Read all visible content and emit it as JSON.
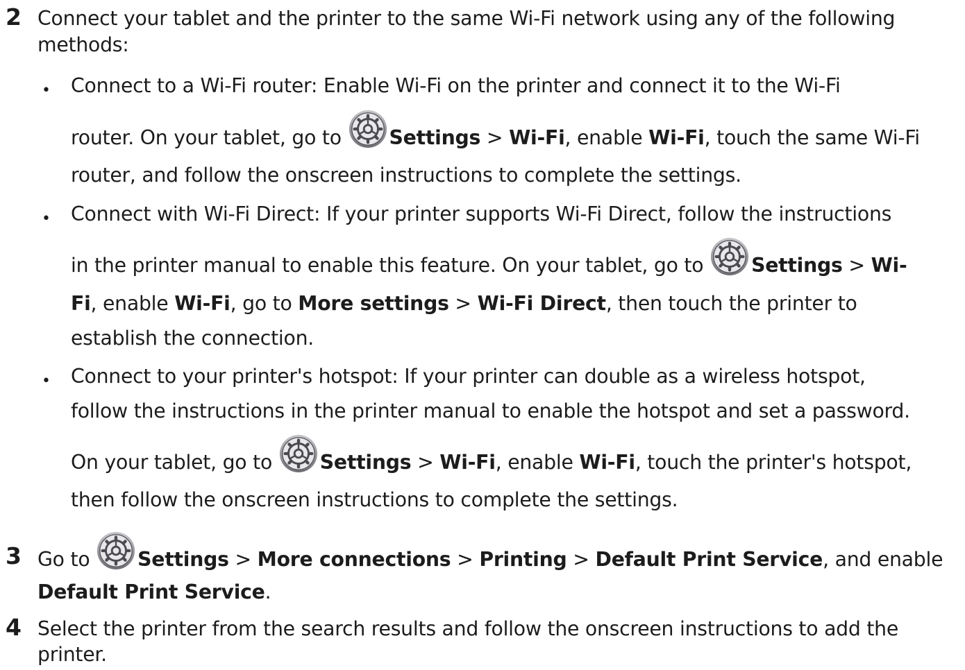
{
  "steps": [
    {
      "number": "2",
      "intro_line1": "Connect your tablet and the printer to the same Wi-Fi network using any of the following",
      "intro_line2": "methods:",
      "bullets": [
        {
          "marker": "•",
          "line1": "Connect to a Wi-Fi router: Enable Wi-Fi on the printer and connect it to the Wi-Fi",
          "line2": {
            "a": "router. On your tablet, go to ",
            "b1": "Settings",
            "c": " > ",
            "b2": "Wi-Fi",
            "d": ", enable ",
            "b3": "Wi-Fi",
            "e": ", touch the same Wi-Fi"
          },
          "line3": "router, and follow the onscreen instructions to complete the settings."
        },
        {
          "marker": "•",
          "line1": "Connect with Wi-Fi Direct: If your printer supports Wi-Fi Direct, follow the instructions",
          "line2": {
            "a": "in the printer manual to enable this feature. On your tablet, go to ",
            "b1": "Settings",
            "c": " > ",
            "b2": "Wi-"
          },
          "line3": {
            "b1": "Fi",
            "a": ", enable ",
            "b2": "Wi-Fi",
            "c": ", go to ",
            "b3": "More settings",
            "d": " > ",
            "b4": "Wi-Fi Direct",
            "e": ", then touch the printer to"
          },
          "line4": "establish the connection."
        },
        {
          "marker": "•",
          "line1": "Connect to your printer's hotspot: If your printer can double as a wireless hotspot,",
          "line2": "follow the instructions in the printer manual to enable the hotspot and set a password.",
          "line3": {
            "a": "On your tablet, go to ",
            "b1": "Settings",
            "c": " > ",
            "b2": "Wi-Fi",
            "d": ", enable ",
            "b3": "Wi-Fi",
            "e": ", touch the printer's hotspot,"
          },
          "line4": "then follow the onscreen instructions to complete the settings."
        }
      ]
    },
    {
      "number": "3",
      "line1": {
        "a": "Go to ",
        "b1": "Settings",
        "c": " > ",
        "b2": "More connections",
        "d": " > ",
        "b3": "Printing",
        "e": " > ",
        "b4": "Default Print Service",
        "f": ", and enable"
      },
      "line2": {
        "b1": "Default Print Service",
        "a": "."
      }
    },
    {
      "number": "4",
      "line1": "Select the printer from the search results and follow the onscreen instructions to add the",
      "line2": "printer."
    }
  ],
  "icons": {
    "settings": "settings-gear-icon"
  }
}
